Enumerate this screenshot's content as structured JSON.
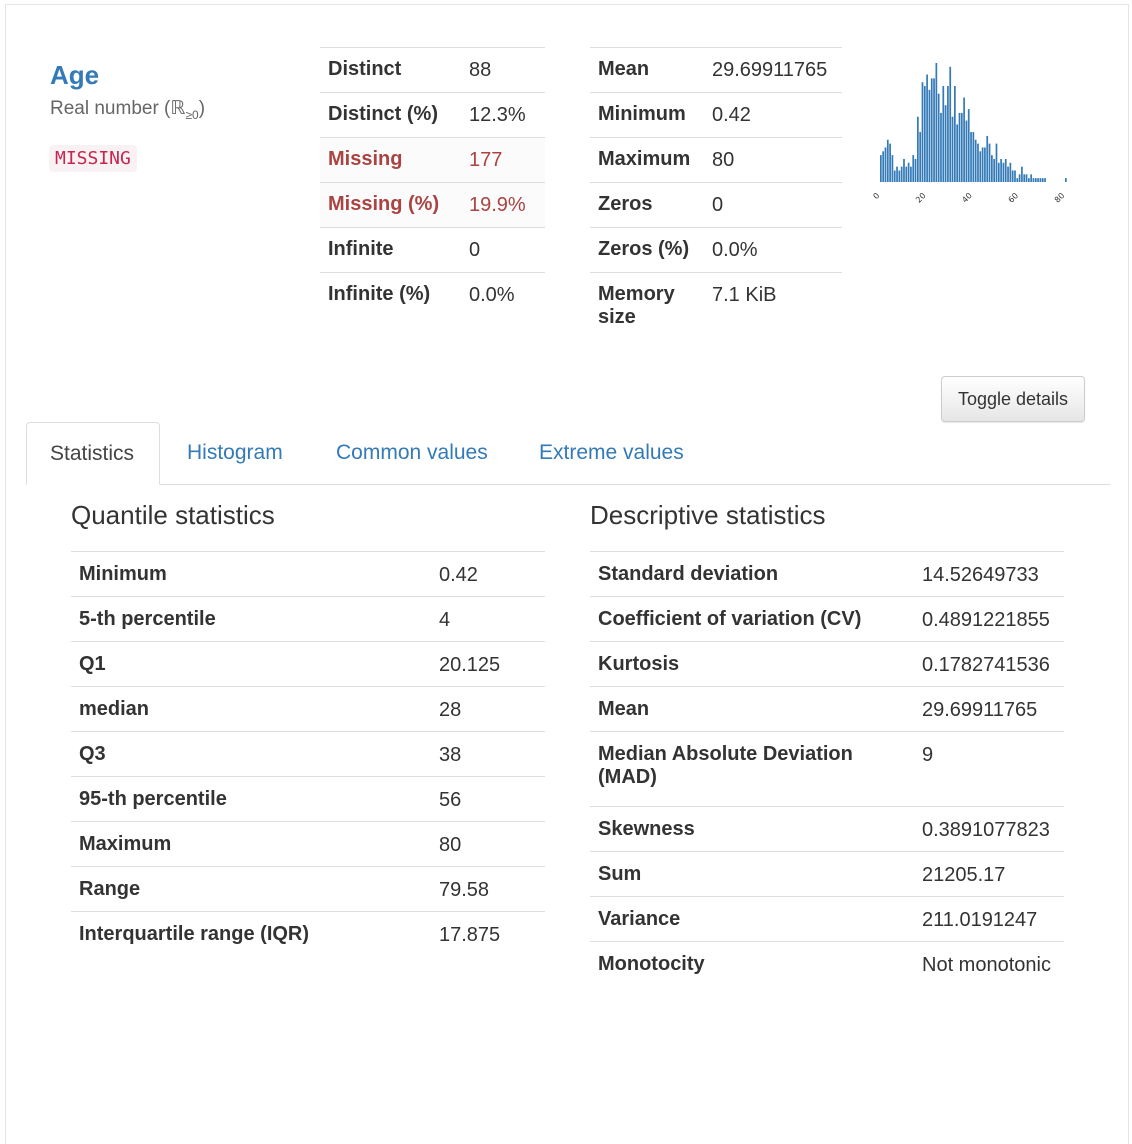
{
  "variable": {
    "name": "Age",
    "type_prefix": "Real number (ℝ",
    "type_sub": "≥0",
    "type_suffix": ")",
    "badge": "MISSING"
  },
  "table_left": [
    {
      "label": "Distinct",
      "value": "88",
      "alert": false
    },
    {
      "label": "Distinct (%)",
      "value": "12.3%",
      "alert": false
    },
    {
      "label": "Missing",
      "value": "177",
      "alert": true
    },
    {
      "label": "Missing (%)",
      "value": "19.9%",
      "alert": true
    },
    {
      "label": "Infinite",
      "value": "0",
      "alert": false
    },
    {
      "label": "Infinite (%)",
      "value": "0.0%",
      "alert": false
    }
  ],
  "table_right": [
    {
      "label": "Mean",
      "value": "29.69911765"
    },
    {
      "label": "Minimum",
      "value": "0.42"
    },
    {
      "label": "Maximum",
      "value": "80"
    },
    {
      "label": "Zeros",
      "value": "0"
    },
    {
      "label": "Zeros (%)",
      "value": "0.0%"
    },
    {
      "label": "Memory size",
      "value": "7.1 KiB"
    }
  ],
  "toggle_button": "Toggle details",
  "tabs": [
    "Statistics",
    "Histogram",
    "Common values",
    "Extreme values"
  ],
  "quantile": {
    "title": "Quantile statistics",
    "rows": [
      {
        "label": "Minimum",
        "value": "0.42"
      },
      {
        "label": "5-th percentile",
        "value": "4"
      },
      {
        "label": "Q1",
        "value": "20.125"
      },
      {
        "label": "median",
        "value": "28"
      },
      {
        "label": "Q3",
        "value": "38"
      },
      {
        "label": "95-th percentile",
        "value": "56"
      },
      {
        "label": "Maximum",
        "value": "80"
      },
      {
        "label": "Range",
        "value": "79.58"
      },
      {
        "label": "Interquartile range (IQR)",
        "value": "17.875"
      }
    ]
  },
  "descriptive": {
    "title": "Descriptive statistics",
    "rows": [
      {
        "label": "Standard deviation",
        "value": "14.52649733"
      },
      {
        "label": "Coefficient of variation (CV)",
        "value": "0.4891221855"
      },
      {
        "label": "Kurtosis",
        "value": "0.1782741536"
      },
      {
        "label": "Mean",
        "value": "29.69911765"
      },
      {
        "label": "Median Absolute Deviation (MAD)",
        "value": "9"
      },
      {
        "label": "Skewness",
        "value": "0.3891077823"
      },
      {
        "label": "Sum",
        "value": "21205.17"
      },
      {
        "label": "Variance",
        "value": "211.0191247"
      },
      {
        "label": "Monotocity",
        "value": "Not monotonic"
      }
    ]
  },
  "chart_data": {
    "type": "bar",
    "bar_color": "#337ab7",
    "xlim": [
      0,
      80
    ],
    "xticks": [
      "0",
      "20",
      "40",
      "60",
      "80"
    ],
    "bin_start": 0,
    "bin_width": 1,
    "counts": [
      7,
      8,
      9,
      11,
      10,
      7,
      3,
      4,
      3,
      4,
      6,
      4,
      5,
      4,
      7,
      6,
      17,
      13,
      26,
      25,
      28,
      24,
      27,
      27,
      31,
      23,
      18,
      25,
      20,
      25,
      30,
      17,
      25,
      15,
      18,
      18,
      22,
      16,
      19,
      13,
      13,
      11,
      10,
      8,
      9,
      9,
      12,
      10,
      7,
      6,
      10,
      5,
      6,
      5,
      6,
      4,
      5,
      3,
      3,
      1,
      2,
      4,
      2,
      2,
      1,
      2,
      1,
      1,
      1,
      1,
      1,
      1,
      0,
      0,
      0,
      0,
      0,
      0,
      0,
      0,
      1
    ]
  }
}
